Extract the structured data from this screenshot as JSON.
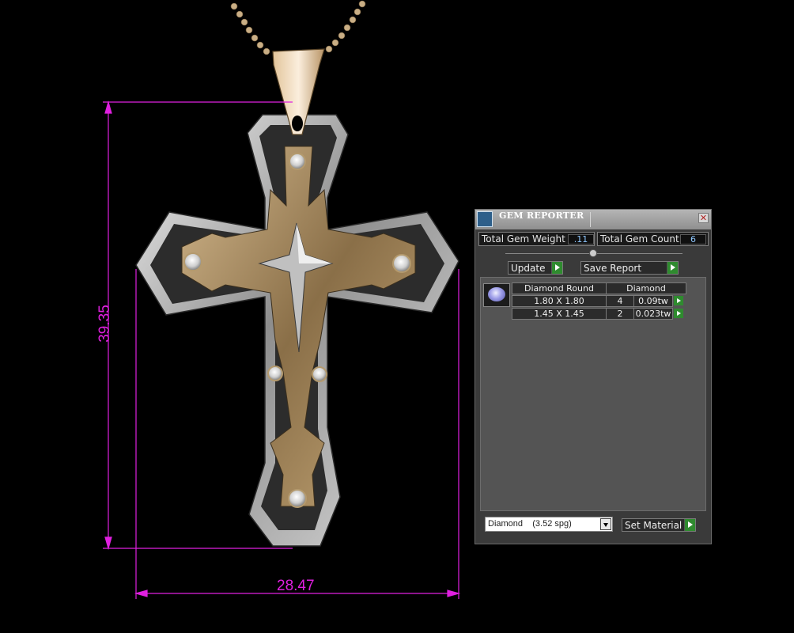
{
  "viewport": {
    "width_dimension": "28.47",
    "height_dimension": "39.35",
    "dimension_color": "#e020e0"
  },
  "panel": {
    "title": "GEM REPORTER",
    "app_icon": "gem-reporter-icon",
    "close_icon": "close-icon",
    "total_gem_weight_label": "Total Gem Weight",
    "total_gem_weight_value": ".11",
    "total_gem_count_label": "Total Gem Count",
    "total_gem_count_value": "6",
    "update_label": "Update",
    "save_report_label": "Save Report",
    "table": {
      "gem_icon": "diamond-gem-icon",
      "header_shape": "Diamond Round",
      "header_material": "Diamond",
      "rows": [
        {
          "size": "1.80 X 1.80",
          "count": "4",
          "weight": "0.09tw"
        },
        {
          "size": "1.45 X 1.45",
          "count": "2",
          "weight": "0.023tw"
        }
      ]
    },
    "material_select_value": "Diamond    (3.52 spg)",
    "set_material_label": "Set Material",
    "go_color": "#2f8b2f"
  }
}
